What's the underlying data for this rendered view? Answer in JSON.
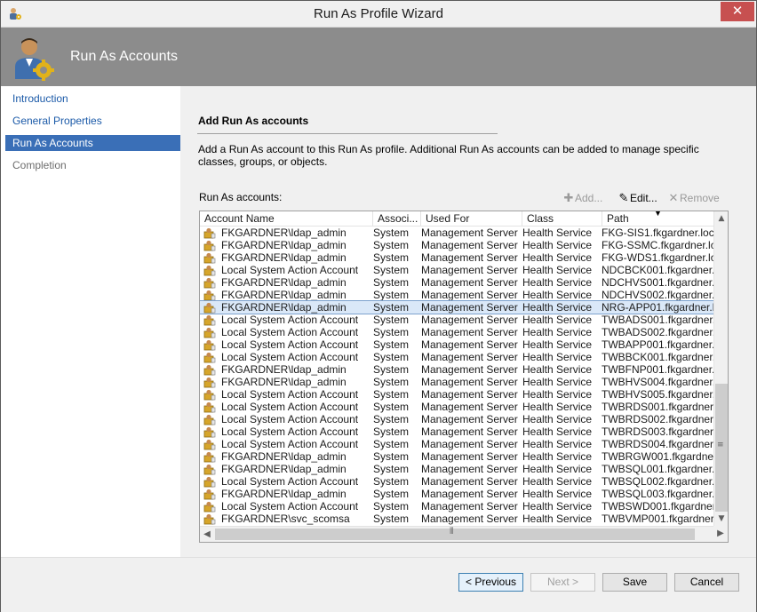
{
  "window": {
    "title": "Run As Profile Wizard",
    "close_glyph": "✕"
  },
  "banner": {
    "title": "Run As Accounts"
  },
  "nav": {
    "items": [
      {
        "label": "Introduction",
        "state": "link"
      },
      {
        "label": "General Properties",
        "state": "link"
      },
      {
        "label": "Run As Accounts",
        "state": "active"
      },
      {
        "label": "Completion",
        "state": "disabled"
      }
    ]
  },
  "main": {
    "section_title": "Add Run As accounts",
    "description": "Add a Run As account to this Run As profile.  Additional Run As accounts can be added to manage specific classes, groups, or objects.",
    "list_label": "Run As accounts:",
    "toolbar": {
      "add_label": "Add...",
      "edit_label": "Edit...",
      "remove_label": "Remove"
    },
    "columns": [
      "Account Name",
      "Associ...",
      "Used For",
      "Class",
      "Path"
    ],
    "rows": [
      {
        "name": "FKGARDNER\\ldap_admin",
        "assoc": "System",
        "used_for": "Management Server",
        "class": "Health Service",
        "path": "FKG-SIS1.fkgardner.local"
      },
      {
        "name": "FKGARDNER\\ldap_admin",
        "assoc": "System",
        "used_for": "Management Server",
        "class": "Health Service",
        "path": "FKG-SSMC.fkgardner.loc"
      },
      {
        "name": "FKGARDNER\\ldap_admin",
        "assoc": "System",
        "used_for": "Management Server",
        "class": "Health Service",
        "path": "FKG-WDS1.fkgardner.loc"
      },
      {
        "name": "Local System Action Account",
        "assoc": "System",
        "used_for": "Management Server",
        "class": "Health Service",
        "path": "NDCBCK001.fkgardner.lo"
      },
      {
        "name": "FKGARDNER\\ldap_admin",
        "assoc": "System",
        "used_for": "Management Server",
        "class": "Health Service",
        "path": "NDCHVS001.fkgardner.lo"
      },
      {
        "name": "FKGARDNER\\ldap_admin",
        "assoc": "System",
        "used_for": "Management Server",
        "class": "Health Service",
        "path": "NDCHVS002.fkgardner.lo"
      },
      {
        "name": "FKGARDNER\\ldap_admin",
        "assoc": "System",
        "used_for": "Management Server",
        "class": "Health Service",
        "path": "NRG-APP01.fkgardner.lo",
        "selected": true
      },
      {
        "name": "Local System Action Account",
        "assoc": "System",
        "used_for": "Management Server",
        "class": "Health Service",
        "path": "TWBADS001.fkgardner.lo"
      },
      {
        "name": "Local System Action Account",
        "assoc": "System",
        "used_for": "Management Server",
        "class": "Health Service",
        "path": "TWBADS002.fkgardner.lo"
      },
      {
        "name": "Local System Action Account",
        "assoc": "System",
        "used_for": "Management Server",
        "class": "Health Service",
        "path": "TWBAPP001.fkgardner.lo"
      },
      {
        "name": "Local System Action Account",
        "assoc": "System",
        "used_for": "Management Server",
        "class": "Health Service",
        "path": "TWBBCK001.fkgardner.lo"
      },
      {
        "name": "FKGARDNER\\ldap_admin",
        "assoc": "System",
        "used_for": "Management Server",
        "class": "Health Service",
        "path": "TWBFNP001.fkgardner.lo"
      },
      {
        "name": "FKGARDNER\\ldap_admin",
        "assoc": "System",
        "used_for": "Management Server",
        "class": "Health Service",
        "path": "TWBHVS004.fkgardner.lo"
      },
      {
        "name": "Local System Action Account",
        "assoc": "System",
        "used_for": "Management Server",
        "class": "Health Service",
        "path": "TWBHVS005.fkgardner.lo"
      },
      {
        "name": "Local System Action Account",
        "assoc": "System",
        "used_for": "Management Server",
        "class": "Health Service",
        "path": "TWBRDS001.fkgardner.lo"
      },
      {
        "name": "Local System Action Account",
        "assoc": "System",
        "used_for": "Management Server",
        "class": "Health Service",
        "path": "TWBRDS002.fkgardner.lo"
      },
      {
        "name": "Local System Action Account",
        "assoc": "System",
        "used_for": "Management Server",
        "class": "Health Service",
        "path": "TWBRDS003.fkgardner.lo"
      },
      {
        "name": "Local System Action Account",
        "assoc": "System",
        "used_for": "Management Server",
        "class": "Health Service",
        "path": "TWBRDS004.fkgardner.lo"
      },
      {
        "name": "FKGARDNER\\ldap_admin",
        "assoc": "System",
        "used_for": "Management Server",
        "class": "Health Service",
        "path": "TWBRGW001.fkgardner.l"
      },
      {
        "name": "FKGARDNER\\ldap_admin",
        "assoc": "System",
        "used_for": "Management Server",
        "class": "Health Service",
        "path": "TWBSQL001.fkgardner.lo"
      },
      {
        "name": "Local System Action Account",
        "assoc": "System",
        "used_for": "Management Server",
        "class": "Health Service",
        "path": "TWBSQL002.fkgardner.lo"
      },
      {
        "name": "FKGARDNER\\ldap_admin",
        "assoc": "System",
        "used_for": "Management Server",
        "class": "Health Service",
        "path": "TWBSQL003.fkgardner.lo"
      },
      {
        "name": "Local System Action Account",
        "assoc": "System",
        "used_for": "Management Server",
        "class": "Health Service",
        "path": "TWBSWD001.fkgardner.l"
      },
      {
        "name": "FKGARDNER\\svc_scomsa",
        "assoc": "System",
        "used_for": "Management Server",
        "class": "Health Service",
        "path": "TWBVMP001.fkgardner.lo"
      }
    ]
  },
  "footer": {
    "previous_label": "< Previous",
    "next_label": "Next >",
    "save_label": "Save",
    "cancel_label": "Cancel"
  },
  "colors": {
    "banner": "#8c8c8c",
    "nav_active": "#3a6fb7",
    "link": "#1b5aa8",
    "close": "#c75050",
    "selected_row": "#dae8f8"
  }
}
